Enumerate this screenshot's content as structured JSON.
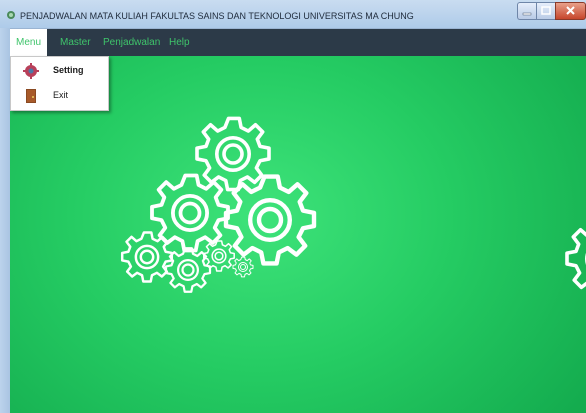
{
  "window": {
    "title": "PENJADWALAN MATA KULIAH FAKULTAS SAINS DAN TEKNOLOGI UNIVERSITAS MA CHUNG",
    "icon": "app-icon"
  },
  "menubar": {
    "items": [
      {
        "label": "Menu",
        "active": true
      },
      {
        "label": "Master"
      },
      {
        "label": "Penjadwalan"
      },
      {
        "label": "Help"
      }
    ]
  },
  "dropdown": {
    "items": [
      {
        "label": "Setting",
        "icon": "gear-icon"
      },
      {
        "label": "Exit",
        "icon": "door-icon"
      }
    ]
  },
  "colors": {
    "menubar_bg": "#2c3a48",
    "menu_text": "#3fc46b",
    "content_green": "#25cc63"
  }
}
